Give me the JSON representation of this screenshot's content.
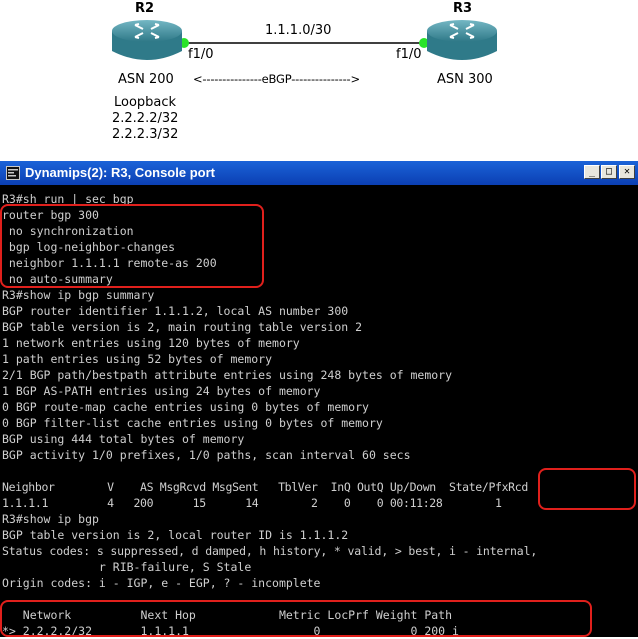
{
  "diagram": {
    "r2": {
      "name": "R2",
      "iface": "f1/0",
      "asn": "ASN 200"
    },
    "r3": {
      "name": "R3",
      "iface": "f1/0",
      "asn": "ASN 300"
    },
    "link_subnet": "1.1.1.0/30",
    "ebgp_arrow": "<---------------eBGP--------------->",
    "loopback": {
      "title": "Loopback",
      "addr1": "2.2.2.2/32",
      "addr2": "2.2.2.3/32"
    },
    "colors": {
      "router": "#3f8fa0",
      "link_dot": "#29e329",
      "link": "#000000"
    }
  },
  "window": {
    "title": "Dynamips(2): R3, Console port",
    "buttons": {
      "minimize": "_",
      "maximize": "□",
      "close": "✕"
    }
  },
  "console": {
    "lines": [
      "R3#sh run | sec bgp",
      "router bgp 300",
      " no synchronization",
      " bgp log-neighbor-changes",
      " neighbor 1.1.1.1 remote-as 200",
      " no auto-summary",
      "R3#show ip bgp summary",
      "BGP router identifier 1.1.1.2, local AS number 300",
      "BGP table version is 2, main routing table version 2",
      "1 network entries using 120 bytes of memory",
      "1 path entries using 52 bytes of memory",
      "2/1 BGP path/bestpath attribute entries using 248 bytes of memory",
      "1 BGP AS-PATH entries using 24 bytes of memory",
      "0 BGP route-map cache entries using 0 bytes of memory",
      "0 BGP filter-list cache entries using 0 bytes of memory",
      "BGP using 444 total bytes of memory",
      "BGP activity 1/0 prefixes, 1/0 paths, scan interval 60 secs",
      "",
      "Neighbor        V    AS MsgRcvd MsgSent   TblVer  InQ OutQ Up/Down  State/PfxRcd",
      "1.1.1.1         4   200      15      14        2    0    0 00:11:28        1",
      "R3#show ip bgp",
      "BGP table version is 2, local router ID is 1.1.1.2",
      "Status codes: s suppressed, d damped, h history, * valid, > best, i - internal,",
      "              r RIB-failure, S Stale",
      "Origin codes: i - IGP, e - EGP, ? - incomplete",
      "",
      "   Network          Next Hop            Metric LocPrf Weight Path",
      "*> 2.2.2.2/32       1.1.1.1                  0             0 200 i"
    ],
    "text_color": "#cfcfcf",
    "highlight_color": "#e0201c"
  }
}
